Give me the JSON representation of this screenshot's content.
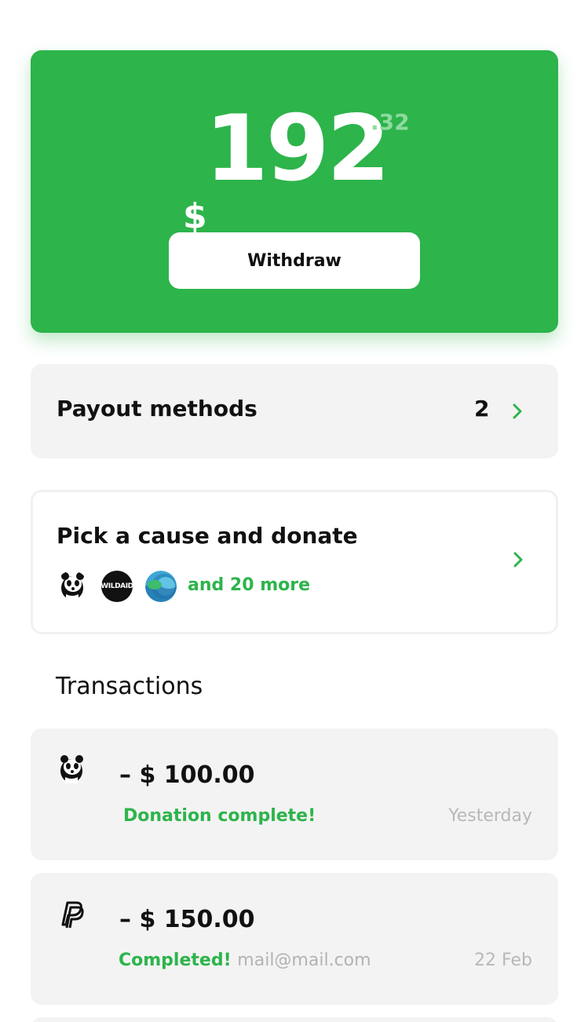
{
  "balance": {
    "currency_symbol": "$",
    "whole": "192",
    "cents": ".32",
    "withdraw_label": "Withdraw"
  },
  "payout": {
    "label": "Payout methods",
    "count": "2"
  },
  "donate": {
    "title": "Pick a cause and donate",
    "wildaid_logo_text": "WILDAID",
    "more_label": "and 20 more"
  },
  "transactions": {
    "title": "Transactions",
    "items": [
      {
        "icon": "panda-icon",
        "amount": "– $ 100.00",
        "status": "Donation complete!",
        "email": "",
        "date": "Yesterday"
      },
      {
        "icon": "paypal-icon",
        "amount": "– $ 150.00",
        "status": "Completed!",
        "email": "mail@mail.com",
        "date": "22 Feb"
      }
    ]
  },
  "colors": {
    "accent_green": "#2db44b",
    "card_gray": "#f3f3f3",
    "muted_text": "#b3b3b3"
  }
}
